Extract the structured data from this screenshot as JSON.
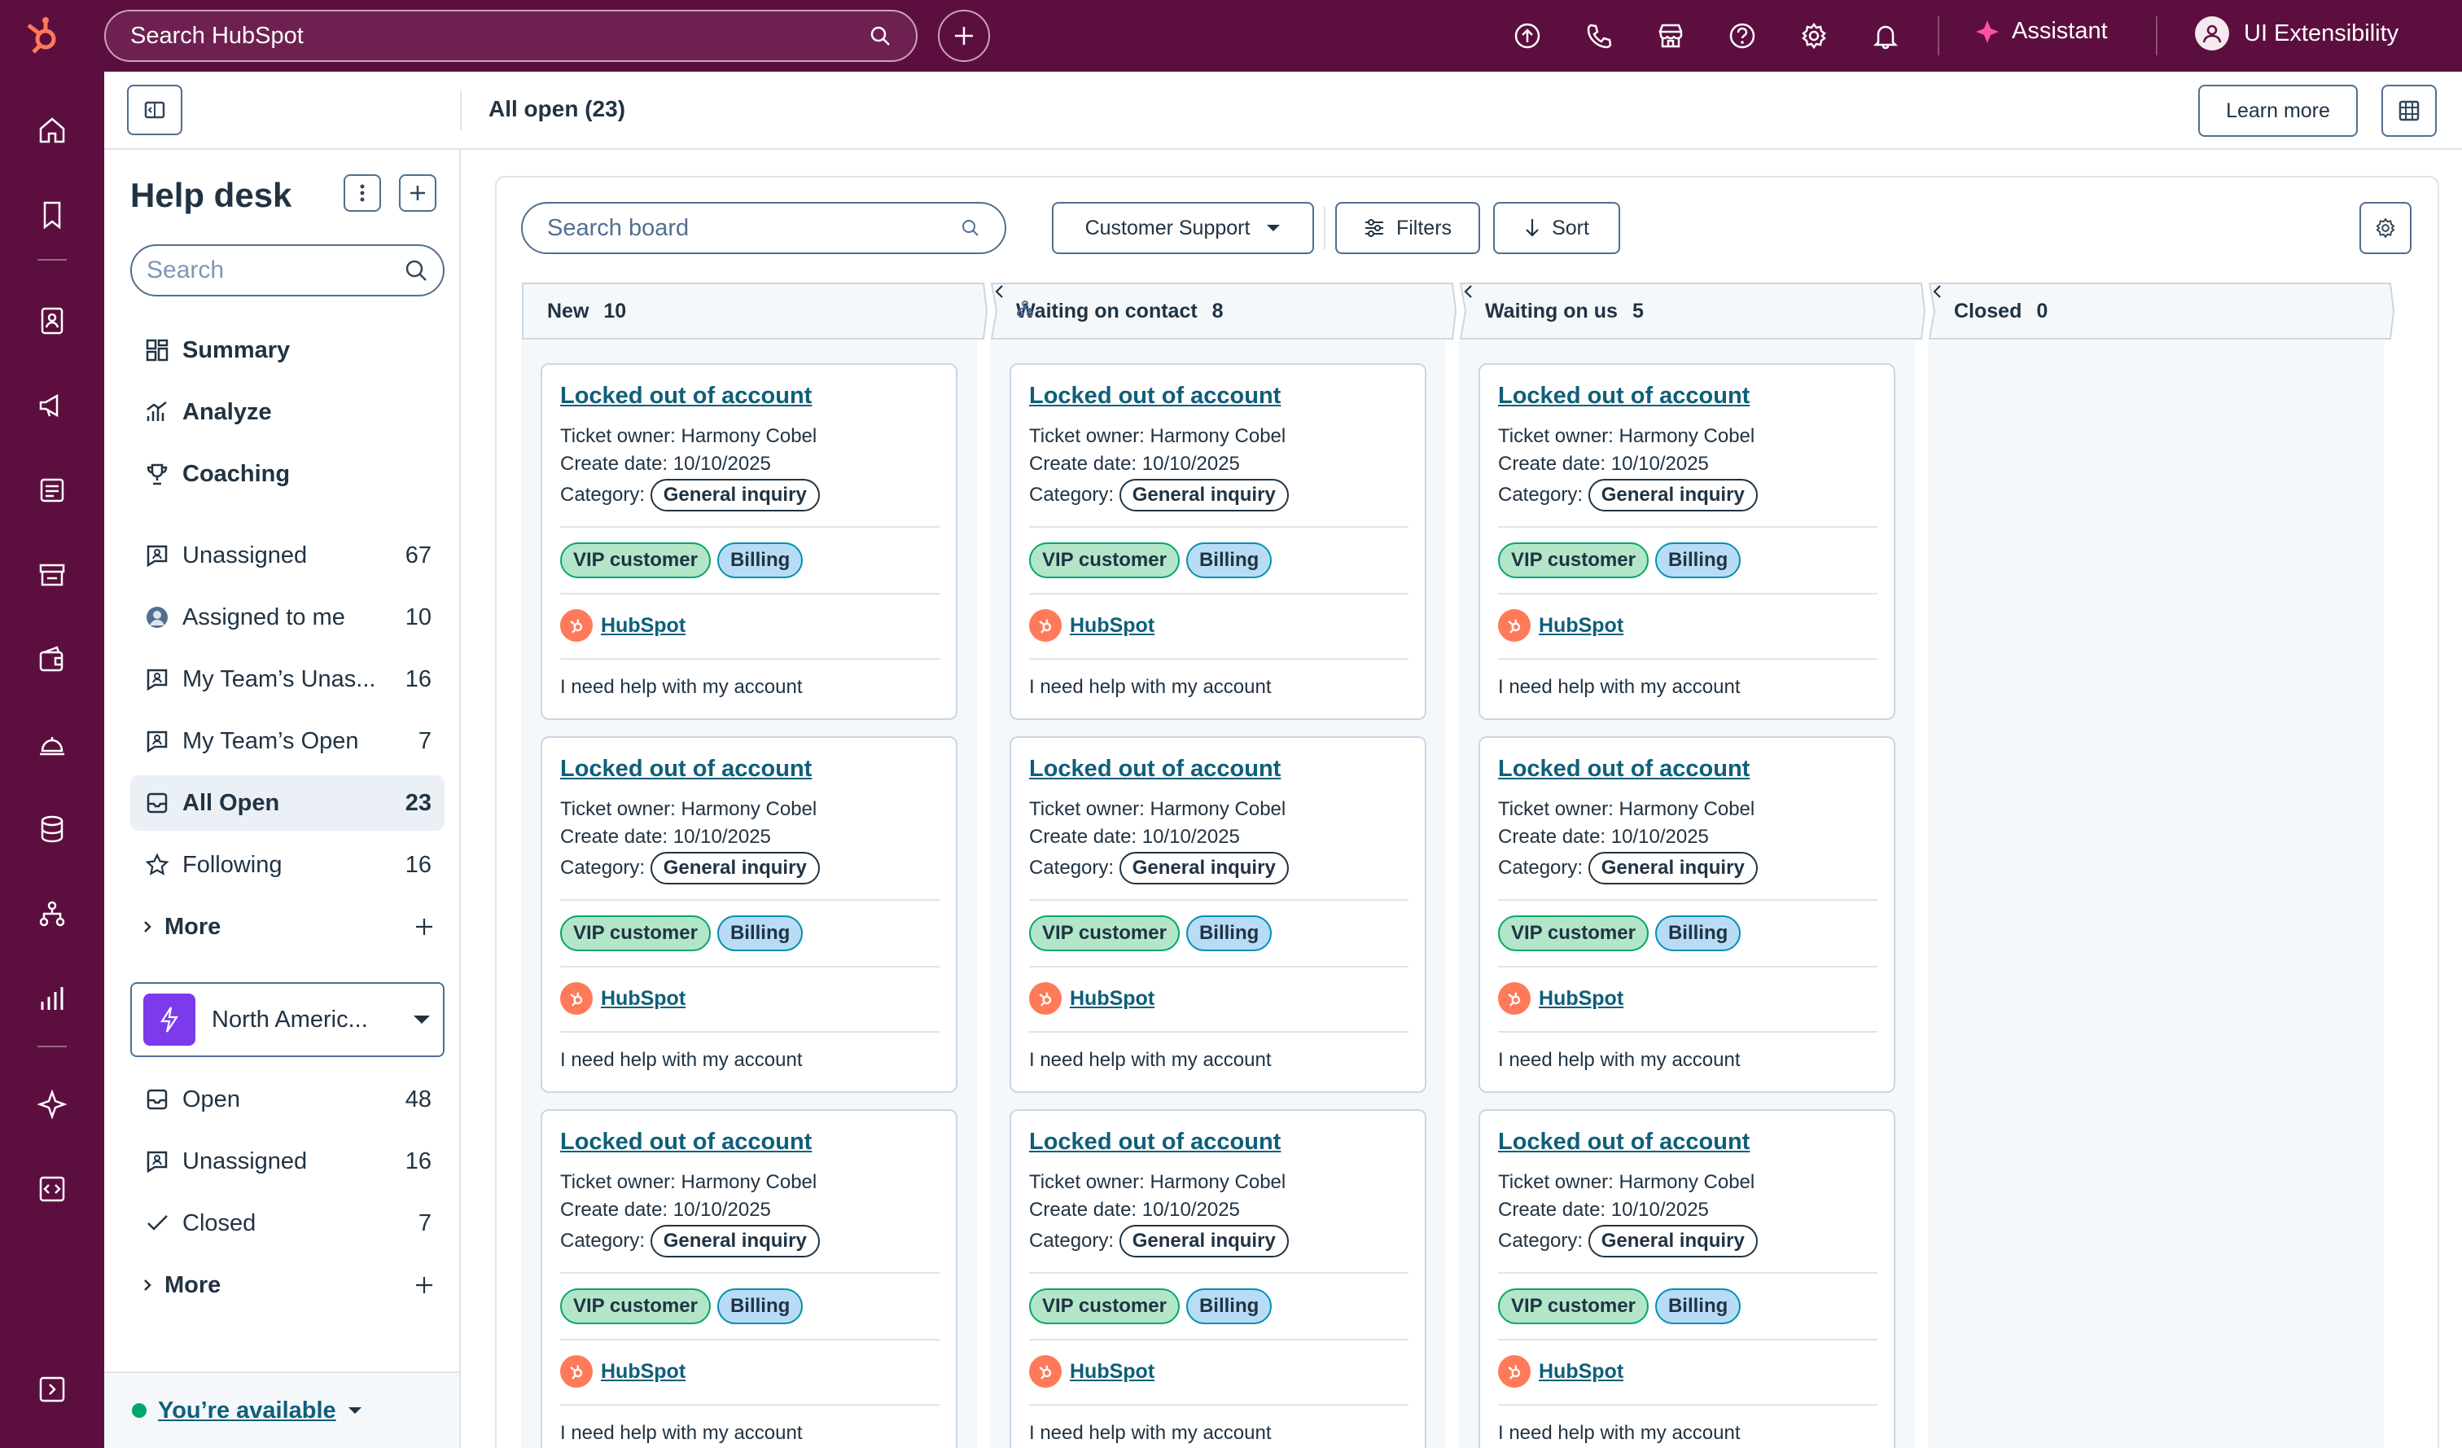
{
  "topbar": {
    "search_placeholder": "Search HubSpot",
    "assistant_label": "Assistant",
    "account_name": "UI Extensibility",
    "brand_color": "#5c0f3e"
  },
  "header": {
    "view_title": "All open (23)",
    "learn_more": "Learn more"
  },
  "sidebar": {
    "title": "Help desk",
    "search_placeholder": "Search",
    "primary_items": [
      {
        "label": "Summary",
        "icon": "summary-icon"
      },
      {
        "label": "Analyze",
        "icon": "analyze-icon"
      },
      {
        "label": "Coaching",
        "icon": "trophy-icon"
      }
    ],
    "views": [
      {
        "label": "Unassigned",
        "count": "67",
        "icon": "unassigned-icon"
      },
      {
        "label": "Assigned to me",
        "count": "10",
        "icon": "avatar-icon"
      },
      {
        "label": "My Team’s Unas...",
        "count": "16",
        "icon": "unassigned-icon"
      },
      {
        "label": "My Team’s Open",
        "count": "7",
        "icon": "unassigned-icon"
      },
      {
        "label": "All Open",
        "count": "23",
        "icon": "inbox-icon"
      },
      {
        "label": "Following",
        "count": "16",
        "icon": "star-icon"
      }
    ],
    "more_label": "More",
    "inbox_name": "North Americ...",
    "inbox_views": [
      {
        "label": "Open",
        "count": "48",
        "icon": "inbox-icon"
      },
      {
        "label": "Unassigned",
        "count": "16",
        "icon": "unassigned-icon"
      },
      {
        "label": "Closed",
        "count": "7",
        "icon": "check-icon"
      }
    ],
    "more_label_2": "More",
    "availability": "You’re available"
  },
  "board": {
    "search_placeholder": "Search board",
    "pipeline": "Customer Support",
    "filters_label": "Filters",
    "sort_label": "Sort",
    "columns": [
      {
        "name": "New",
        "count": "10"
      },
      {
        "name": "Waiting on contact",
        "count": "8"
      },
      {
        "name": "Waiting on us",
        "count": "5"
      },
      {
        "name": "Closed",
        "count": "0"
      }
    ],
    "card": {
      "title": "Locked out of account",
      "owner_label": "Ticket owner:",
      "owner": "Harmony Cobel",
      "date_label": "Create date:",
      "date": "10/10/2025",
      "category_label": "Category:",
      "category": "General inquiry",
      "tag1": "VIP customer",
      "tag2": "Billing",
      "company": "HubSpot",
      "description": "I need help with my account"
    }
  }
}
